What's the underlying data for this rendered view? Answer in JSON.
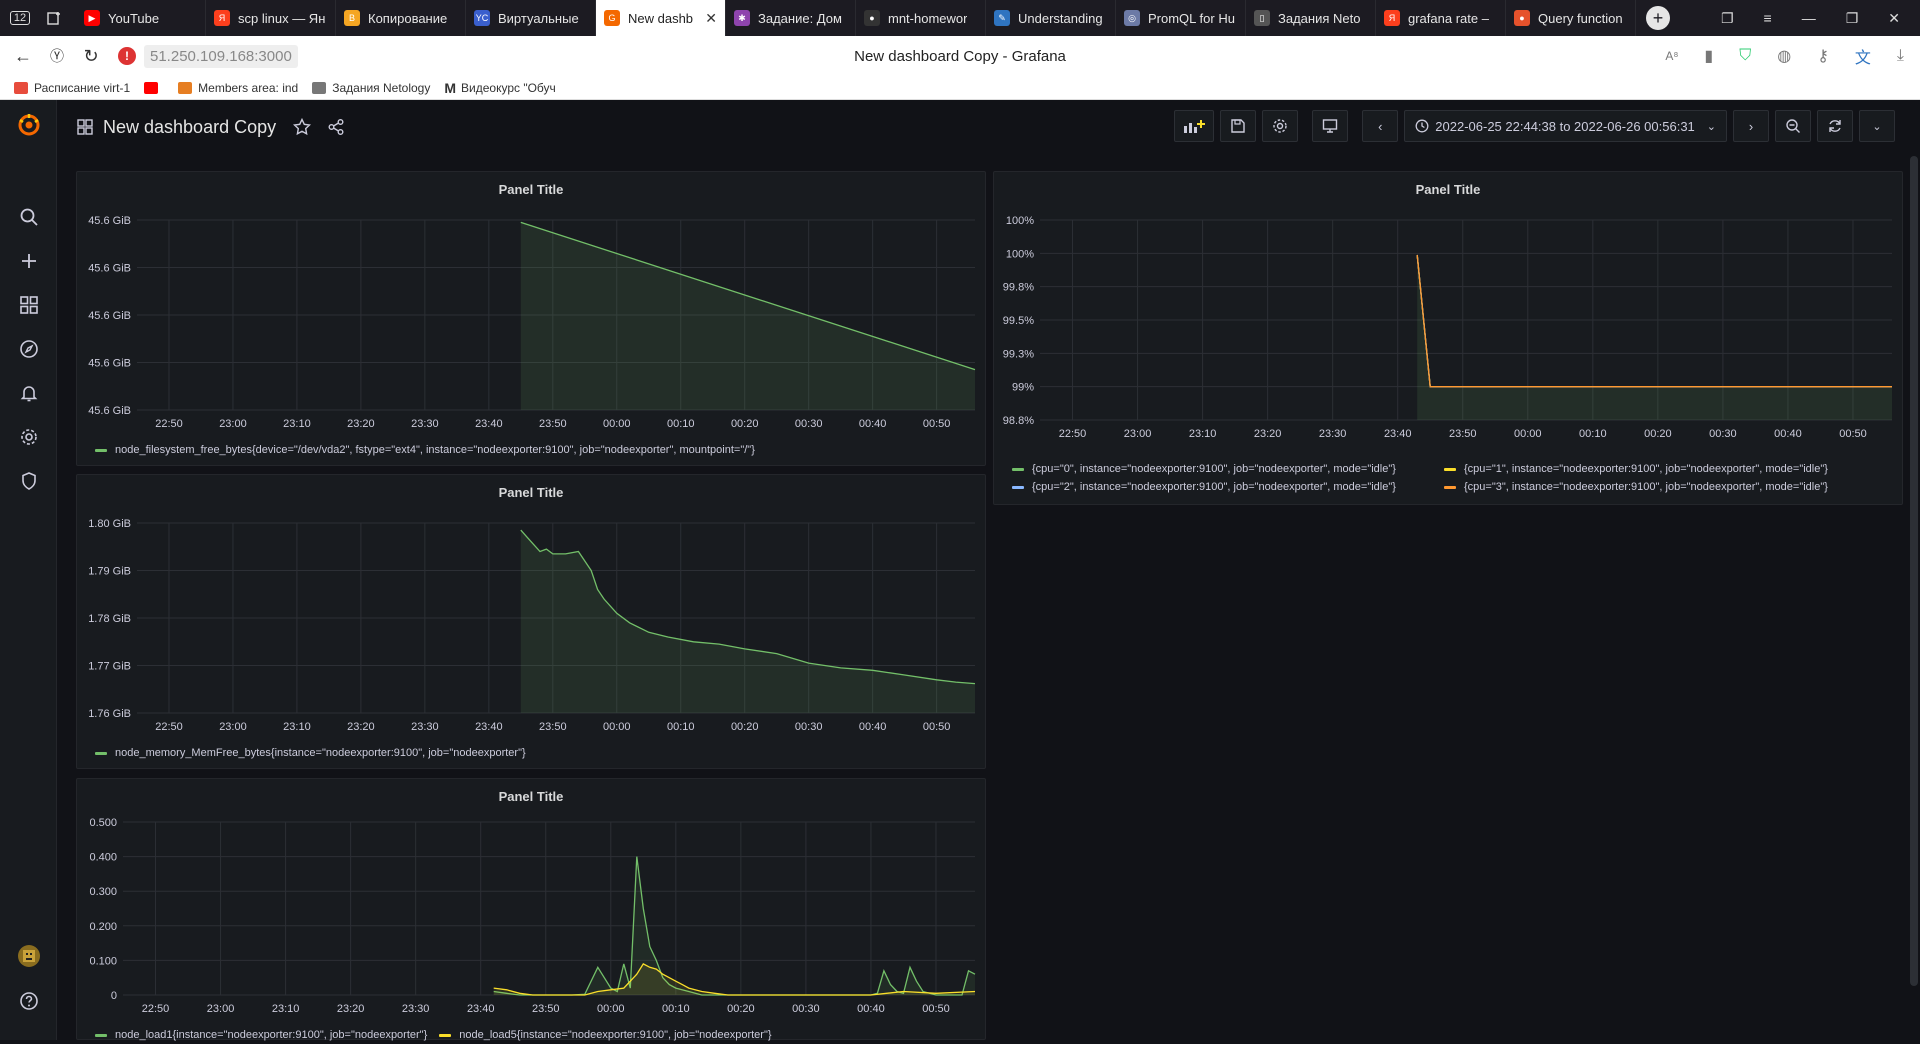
{
  "browser": {
    "tabs": [
      {
        "label": "YouTube",
        "color": "#ff0000",
        "glyph": "▶"
      },
      {
        "label": "scp linux — Ян",
        "color": "#fc3f1d",
        "glyph": "Я"
      },
      {
        "label": "Копирование",
        "color": "#f5a623",
        "glyph": "B"
      },
      {
        "label": "Виртуальные",
        "color": "#3a5fcd",
        "glyph": "YC"
      },
      {
        "label": "New dashb",
        "color": "#f46800",
        "glyph": "G",
        "active": true
      },
      {
        "label": "Задание: Дом",
        "color": "#8e44ad",
        "glyph": "✱"
      },
      {
        "label": "mnt-homewor",
        "color": "#333333",
        "glyph": "●"
      },
      {
        "label": "Understanding",
        "color": "#2f74c0",
        "glyph": "✎"
      },
      {
        "label": "PromQL for Hu",
        "color": "#6c7aa6",
        "glyph": "◎"
      },
      {
        "label": "Задания Neto",
        "color": "#555555",
        "glyph": "▯"
      },
      {
        "label": "grafana rate –",
        "color": "#fc3f1d",
        "glyph": "Я"
      },
      {
        "label": "Query function",
        "color": "#e6522c",
        "glyph": "●"
      }
    ],
    "tab_count_badge": "12",
    "address": "51.250.109.168:3000",
    "window_title": "New dashboard Copy - Grafana",
    "bookmarks": [
      {
        "label": "Расписание virt-1",
        "color": "#e74c3c"
      },
      {
        "label": "",
        "color": "#ff0000"
      },
      {
        "label": "Members area: ind",
        "color": "#e67e22"
      },
      {
        "label": "Задания Netology",
        "color": "#777777"
      },
      {
        "label": "Видеокурс \"Обуч",
        "color": "#222222",
        "glyph": "M"
      }
    ]
  },
  "dashboard": {
    "title": "New dashboard Copy",
    "time_range": "2022-06-25 22:44:38 to 2022-06-26 00:56:31"
  },
  "colors": {
    "bg": "#111217",
    "panel": "#181b1f",
    "grid": "#2c2f35",
    "green": "#73bf69",
    "yellow": "#fade2a",
    "blue": "#5794f2",
    "cyan": "#8ab8ff",
    "orange": "#ff9830",
    "orange2": "#f2cc0c"
  },
  "panels": [
    {
      "title": "Panel Title",
      "legend": [
        "node_filesystem_free_bytes{device=\"/dev/vda2\", fstype=\"ext4\", instance=\"nodeexporter:9100\", job=\"nodeexporter\", mountpoint=\"/\"}"
      ]
    },
    {
      "title": "Panel Title",
      "legend": [
        "node_memory_MemFree_bytes{instance=\"nodeexporter:9100\", job=\"nodeexporter\"}"
      ]
    },
    {
      "title": "Panel Title",
      "legend": [
        "node_load1{instance=\"nodeexporter:9100\", job=\"nodeexporter\"}",
        "node_load5{instance=\"nodeexporter:9100\", job=\"nodeexporter\"}"
      ]
    },
    {
      "title": "Panel Title",
      "legend": [
        "{cpu=\"0\", instance=\"nodeexporter:9100\", job=\"nodeexporter\", mode=\"idle\"}",
        "{cpu=\"1\", instance=\"nodeexporter:9100\", job=\"nodeexporter\", mode=\"idle\"}",
        "{cpu=\"2\", instance=\"nodeexporter:9100\", job=\"nodeexporter\", mode=\"idle\"}",
        "{cpu=\"3\", instance=\"nodeexporter:9100\", job=\"nodeexporter\", mode=\"idle\"}"
      ]
    }
  ],
  "chart_data": [
    {
      "type": "area",
      "title": "Panel Title",
      "x_ticks": [
        "22:50",
        "23:00",
        "23:10",
        "23:20",
        "23:30",
        "23:40",
        "23:50",
        "00:00",
        "00:10",
        "00:20",
        "00:30",
        "00:40",
        "00:50"
      ],
      "y_ticks": [
        "45.6 GiB",
        "45.6 GiB",
        "45.6 GiB",
        "45.6 GiB",
        "45.6 GiB"
      ],
      "xlim": [
        -5,
        126
      ],
      "ylim": [
        0,
        4
      ],
      "series": [
        {
          "name": "node_filesystem_free_bytes{device=\"/dev/vda2\", fstype=\"ext4\", instance=\"nodeexporter:9100\", job=\"nodeexporter\", mountpoint=\"/\"}",
          "x": [
            55,
            126
          ],
          "y": [
            3.95,
            0.85
          ]
        }
      ]
    },
    {
      "type": "area",
      "title": "Panel Title",
      "x_ticks": [
        "22:50",
        "23:00",
        "23:10",
        "23:20",
        "23:30",
        "23:40",
        "23:50",
        "00:00",
        "00:10",
        "00:20",
        "00:30",
        "00:40",
        "00:50"
      ],
      "y_ticks": [
        "1.80 GiB",
        "1.79 GiB",
        "1.78 GiB",
        "1.77 GiB",
        "1.76 GiB"
      ],
      "xlim": [
        -5,
        126
      ],
      "ylim": [
        1.76,
        1.8
      ],
      "series": [
        {
          "name": "node_memory_MemFree_bytes{instance=\"nodeexporter:9100\", job=\"nodeexporter\"}",
          "x": [
            55,
            56,
            57,
            58,
            59,
            60,
            62,
            64,
            66,
            67,
            68,
            70,
            72,
            75,
            78,
            82,
            86,
            90,
            95,
            100,
            105,
            110,
            115,
            120,
            123,
            126
          ],
          "y": [
            1.7985,
            1.797,
            1.7955,
            1.794,
            1.7945,
            1.7935,
            1.7935,
            1.794,
            1.79,
            1.786,
            1.784,
            1.781,
            1.779,
            1.777,
            1.776,
            1.775,
            1.7745,
            1.7735,
            1.7725,
            1.7705,
            1.7695,
            1.769,
            1.768,
            1.767,
            1.7665,
            1.7662
          ]
        }
      ]
    },
    {
      "type": "line",
      "title": "Panel Title",
      "x_ticks": [
        "22:50",
        "23:00",
        "23:10",
        "23:20",
        "23:30",
        "23:40",
        "23:50",
        "00:00",
        "00:10",
        "00:20",
        "00:30",
        "00:40",
        "00:50"
      ],
      "y_ticks": [
        "0.500",
        "0.400",
        "0.300",
        "0.200",
        "0.100",
        "0"
      ],
      "xlim": [
        -5,
        126
      ],
      "ylim": [
        0,
        0.5
      ],
      "series": [
        {
          "name": "node_load1{instance=\"nodeexporter:9100\", job=\"nodeexporter\"}",
          "x": [
            52,
            54,
            56,
            58,
            60,
            62,
            64,
            66,
            68,
            70,
            71,
            72,
            73,
            74,
            75,
            76,
            77,
            78,
            79,
            80,
            82,
            84,
            86,
            88,
            90,
            92,
            94,
            96,
            98,
            100,
            102,
            104,
            106,
            108,
            110,
            111,
            112,
            113,
            114,
            115,
            116,
            117,
            118,
            120,
            122,
            124,
            125,
            126
          ],
          "y": [
            0.01,
            0.005,
            0,
            0,
            0,
            0,
            0,
            0.002,
            0.08,
            0.02,
            0.01,
            0.09,
            0.02,
            0.4,
            0.25,
            0.14,
            0.1,
            0.05,
            0.03,
            0.02,
            0.01,
            0,
            0,
            0,
            0,
            0,
            0,
            0,
            0,
            0,
            0,
            0,
            0,
            0,
            0,
            0.005,
            0.07,
            0.03,
            0.01,
            0.005,
            0.08,
            0.04,
            0.01,
            0,
            0,
            0,
            0.07,
            0.06
          ]
        },
        {
          "name": "node_load5{instance=\"nodeexporter:9100\", job=\"nodeexporter\"}",
          "x": [
            52,
            54,
            56,
            58,
            60,
            62,
            64,
            66,
            68,
            70,
            72,
            74,
            75,
            76,
            77,
            78,
            79,
            80,
            81,
            82,
            84,
            86,
            88,
            90,
            95,
            100,
            105,
            110,
            115,
            120,
            126
          ],
          "y": [
            0.02,
            0.015,
            0.005,
            0,
            0,
            0,
            0,
            0,
            0.01,
            0.015,
            0.02,
            0.06,
            0.09,
            0.08,
            0.075,
            0.06,
            0.05,
            0.04,
            0.03,
            0.02,
            0.01,
            0.005,
            0,
            0,
            0,
            0,
            0,
            0,
            0.01,
            0.005,
            0.01
          ]
        }
      ]
    },
    {
      "type": "area",
      "title": "Panel Title",
      "x_ticks": [
        "22:50",
        "23:00",
        "23:10",
        "23:20",
        "23:30",
        "23:40",
        "23:50",
        "00:00",
        "00:10",
        "00:20",
        "00:30",
        "00:40",
        "00:50"
      ],
      "y_ticks": [
        "100%",
        "100%",
        "99.8%",
        "99.5%",
        "99.3%",
        "99%",
        "98.8%"
      ],
      "xlim": [
        -5,
        126
      ],
      "ylim": [
        0,
        6
      ],
      "series": [
        {
          "name": "{cpu=\"0\", instance=\"nodeexporter:9100\", job=\"nodeexporter\", mode=\"idle\"}",
          "x": [
            53,
            55,
            126
          ],
          "y": [
            4.95,
            1,
            1
          ]
        },
        {
          "name": "{cpu=\"1\", instance=\"nodeexporter:9100\", job=\"nodeexporter\", mode=\"idle\"}",
          "x": [
            53,
            55,
            126
          ],
          "y": [
            4.95,
            1,
            1
          ]
        },
        {
          "name": "{cpu=\"2\", instance=\"nodeexporter:9100\", job=\"nodeexporter\", mode=\"idle\"}",
          "x": [
            53,
            55,
            126
          ],
          "y": [
            4.95,
            1,
            1
          ]
        },
        {
          "name": "{cpu=\"3\", instance=\"nodeexporter:9100\", job=\"nodeexporter\", mode=\"idle\"}",
          "x": [
            53,
            55,
            126
          ],
          "y": [
            4.95,
            1,
            1
          ]
        }
      ]
    }
  ]
}
